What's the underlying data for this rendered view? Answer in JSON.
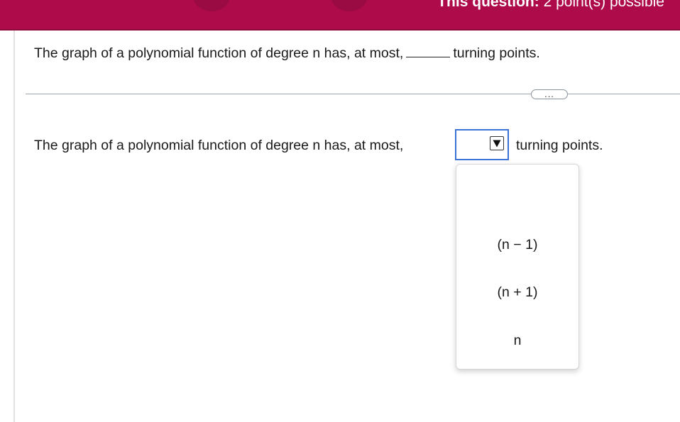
{
  "header": {
    "title_bold": "This question:",
    "title_rest": " 2 point(s) possible",
    "colors": {
      "bar": "#ad0b4a",
      "circles": "#9a0a43"
    }
  },
  "question": {
    "summary_text_before": "The graph of a polynomial function of degree n has, at most,",
    "summary_text_after": "turning points.",
    "more_button": "...",
    "prompt_before": "The graph of a polynomial function of degree n has, at most,",
    "prompt_after": "turning points."
  },
  "answer_dropdown": {
    "selected_value": "",
    "arrow_icon": "triangle-down-icon",
    "options": [
      "",
      "(n − 1)",
      "(n + 1)",
      "n"
    ]
  },
  "colors": {
    "focus_border": "#3a73d4"
  }
}
